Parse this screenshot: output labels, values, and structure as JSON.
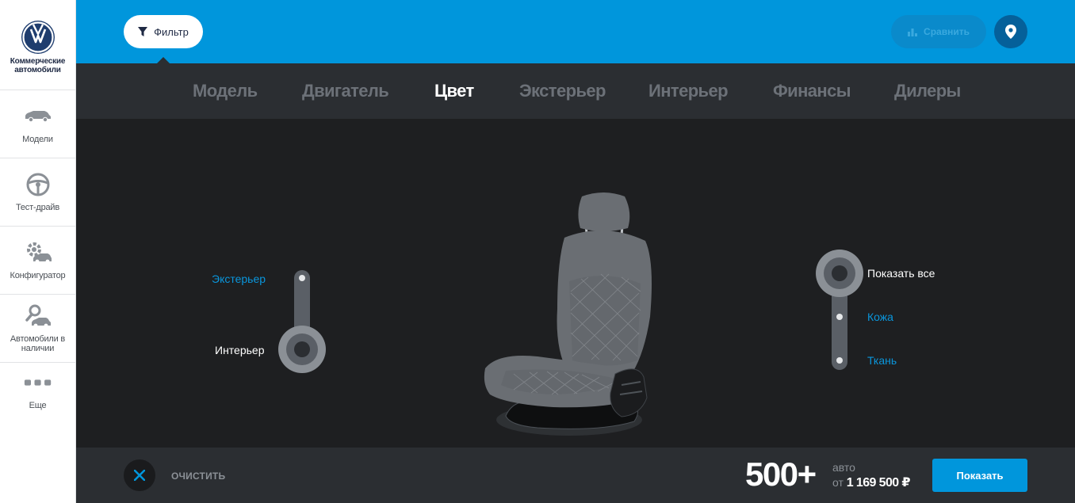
{
  "brand": {
    "logo": "vw-logo",
    "line1": "Коммерческие",
    "line2": "автомобили"
  },
  "sidebar": {
    "items": [
      {
        "label": "Модели",
        "icon": "car-icon"
      },
      {
        "label": "Тест-драйв",
        "icon": "steering-wheel-icon"
      },
      {
        "label": "Конфигуратор",
        "icon": "gear-car-icon"
      },
      {
        "label": "Автомобили в наличии",
        "icon": "car-search-icon"
      },
      {
        "label": "Еще",
        "icon": "more-dots-icon"
      }
    ]
  },
  "topbar": {
    "filter_label": "Фильтр",
    "compare_label": "Сравнить",
    "colors": {
      "background": "#0096dc"
    }
  },
  "tabs": [
    {
      "label": "Модель",
      "active": false
    },
    {
      "label": "Двигатель",
      "active": false
    },
    {
      "label": "Цвет",
      "active": true
    },
    {
      "label": "Экстерьер",
      "active": false
    },
    {
      "label": "Интерьер",
      "active": false
    },
    {
      "label": "Финансы",
      "active": false
    },
    {
      "label": "Дилеры",
      "active": false
    }
  ],
  "color_area": {
    "area_switch": {
      "options": [
        "Экстерьер",
        "Интерьер"
      ],
      "selected": "Интерьер"
    },
    "material_switch": {
      "options": [
        "Показать все",
        "Кожа",
        "Ткань"
      ],
      "selected": "Показать все"
    },
    "image": "car-seat"
  },
  "bottombar": {
    "clear_label": "ОЧИСТИТЬ",
    "count": "500+",
    "count_unit": "авто",
    "price_prefix": "от",
    "price": "1 169 500 ₽",
    "show_label": "Показать"
  }
}
